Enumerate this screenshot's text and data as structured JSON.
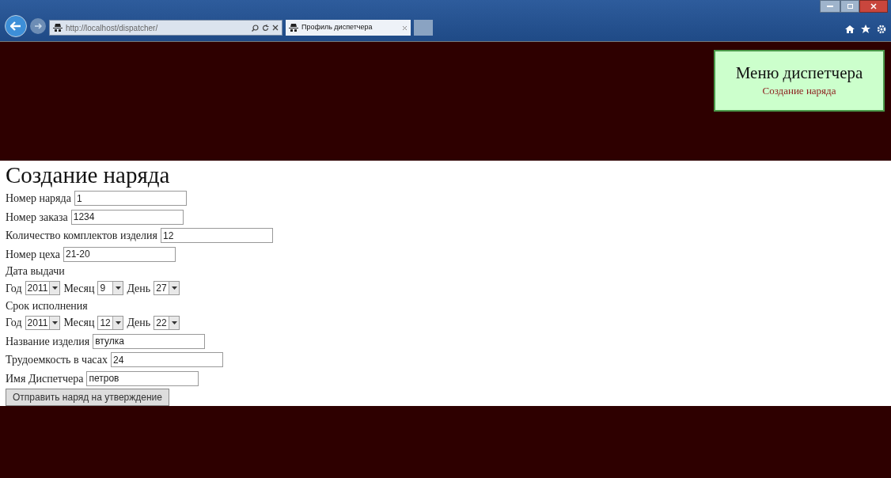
{
  "browser": {
    "address": "http://localhost/dispatcher/",
    "tab": {
      "title": "Профиль диспетчера",
      "selected": true
    }
  },
  "menu": {
    "title": "Меню диспетчера",
    "links": [
      "Создание наряда"
    ]
  },
  "form": {
    "heading": "Создание наряда",
    "rows": [
      {
        "kind": "text",
        "label": "Номер наряда",
        "value": "1"
      },
      {
        "kind": "text",
        "label": "Номер заказа",
        "value": "1234"
      },
      {
        "kind": "text",
        "label": "Количество комплектов изделия",
        "value": "12"
      },
      {
        "kind": "text",
        "label": "Номер цеха",
        "value": "21-20"
      },
      {
        "kind": "caption",
        "label": "Дата выдачи"
      },
      {
        "kind": "date",
        "parts": [
          {
            "label": "Год",
            "value": "2011"
          },
          {
            "label": "Месяц",
            "value": "9"
          },
          {
            "label": "День",
            "value": "27"
          }
        ]
      },
      {
        "kind": "caption",
        "label": "Срок исполнения"
      },
      {
        "kind": "date",
        "parts": [
          {
            "label": "Год",
            "value": "2011"
          },
          {
            "label": "Месяц",
            "value": "12"
          },
          {
            "label": "День",
            "value": "22"
          }
        ]
      },
      {
        "kind": "text",
        "label": "Название изделия",
        "value": "втулка"
      },
      {
        "kind": "text",
        "label": "Трудоемкость в часах",
        "value": "24"
      },
      {
        "kind": "text",
        "label": "Имя Диспетчера",
        "value": "петров"
      }
    ],
    "submit": "Отправить наряд на утверждение"
  }
}
